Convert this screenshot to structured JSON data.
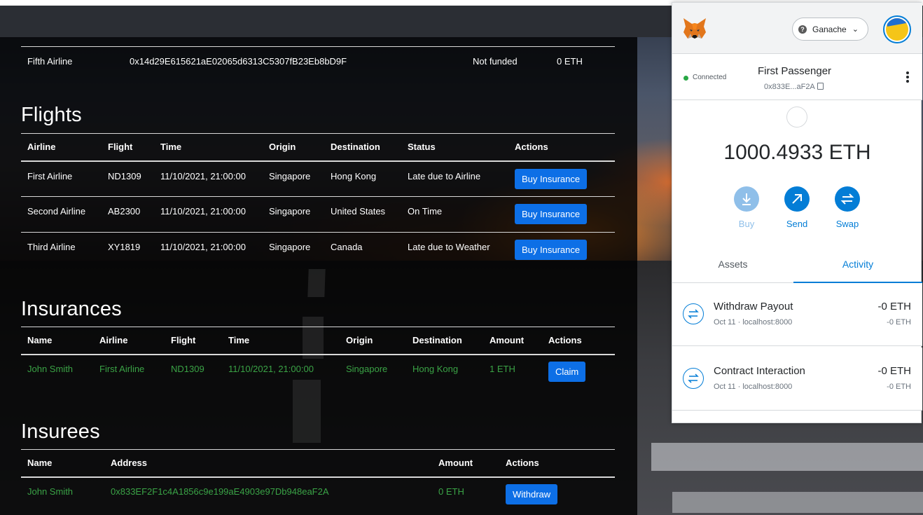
{
  "funding_row": {
    "name": "Fifth Airline",
    "address": "0x14d29E615621aE02065d6313C5307fB23Eb8bD9F",
    "status": "Not funded",
    "amount": "0 ETH"
  },
  "flights": {
    "title": "Flights",
    "headers": [
      "Airline",
      "Flight",
      "Time",
      "Origin",
      "Destination",
      "Status",
      "Actions"
    ],
    "rows": [
      {
        "airline": "First Airline",
        "flight": "ND1309",
        "time": "11/10/2021, 21:00:00",
        "origin": "Singapore",
        "destination": "Hong Kong",
        "status": "Late due to Airline",
        "action": "Buy Insurance"
      },
      {
        "airline": "Second Airline",
        "flight": "AB2300",
        "time": "11/10/2021, 21:00:00",
        "origin": "Singapore",
        "destination": "United States",
        "status": "On Time",
        "action": "Buy Insurance"
      },
      {
        "airline": "Third Airline",
        "flight": "XY1819",
        "time": "11/10/2021, 21:00:00",
        "origin": "Singapore",
        "destination": "Canada",
        "status": "Late due to Weather",
        "action": "Buy Insurance"
      }
    ]
  },
  "insurances": {
    "title": "Insurances",
    "headers": [
      "Name",
      "Airline",
      "Flight",
      "Time",
      "Origin",
      "Destination",
      "Amount",
      "Actions"
    ],
    "rows": [
      {
        "name": "John Smith",
        "airline": "First Airline",
        "flight": "ND1309",
        "time": "11/10/2021, 21:00:00",
        "origin": "Singapore",
        "destination": "Hong Kong",
        "amount": "1 ETH",
        "action": "Claim"
      }
    ]
  },
  "insurees": {
    "title": "Insurees",
    "headers": [
      "Name",
      "Address",
      "Amount",
      "Actions"
    ],
    "rows": [
      {
        "name": "John Smith",
        "address": "0x833EF2F1c4A1856c9e199aE4903e97Db948eaF2A",
        "amount": "0 ETH",
        "action": "Withdraw"
      }
    ]
  },
  "metamask": {
    "network": "Ganache",
    "connection_status": "Connected",
    "account_name": "First Passenger",
    "account_address": "0x833E...aF2A",
    "balance": "1000.4933 ETH",
    "actions": {
      "buy": "Buy",
      "send": "Send",
      "swap": "Swap"
    },
    "tabs": {
      "assets": "Assets",
      "activity": "Activity"
    },
    "activity": [
      {
        "title": "Withdraw Payout",
        "subtitle": "Oct 11 · localhost:8000",
        "amount": "-0 ETH",
        "fiat": "-0 ETH"
      },
      {
        "title": "Contract Interaction",
        "subtitle": "Oct 11 · localhost:8000",
        "amount": "-0 ETH",
        "fiat": "-0 ETH"
      }
    ]
  },
  "colors": {
    "primary_button": "#0d6fe6",
    "insurance_text": "#3aa346",
    "metamask_blue": "#037dd6"
  }
}
